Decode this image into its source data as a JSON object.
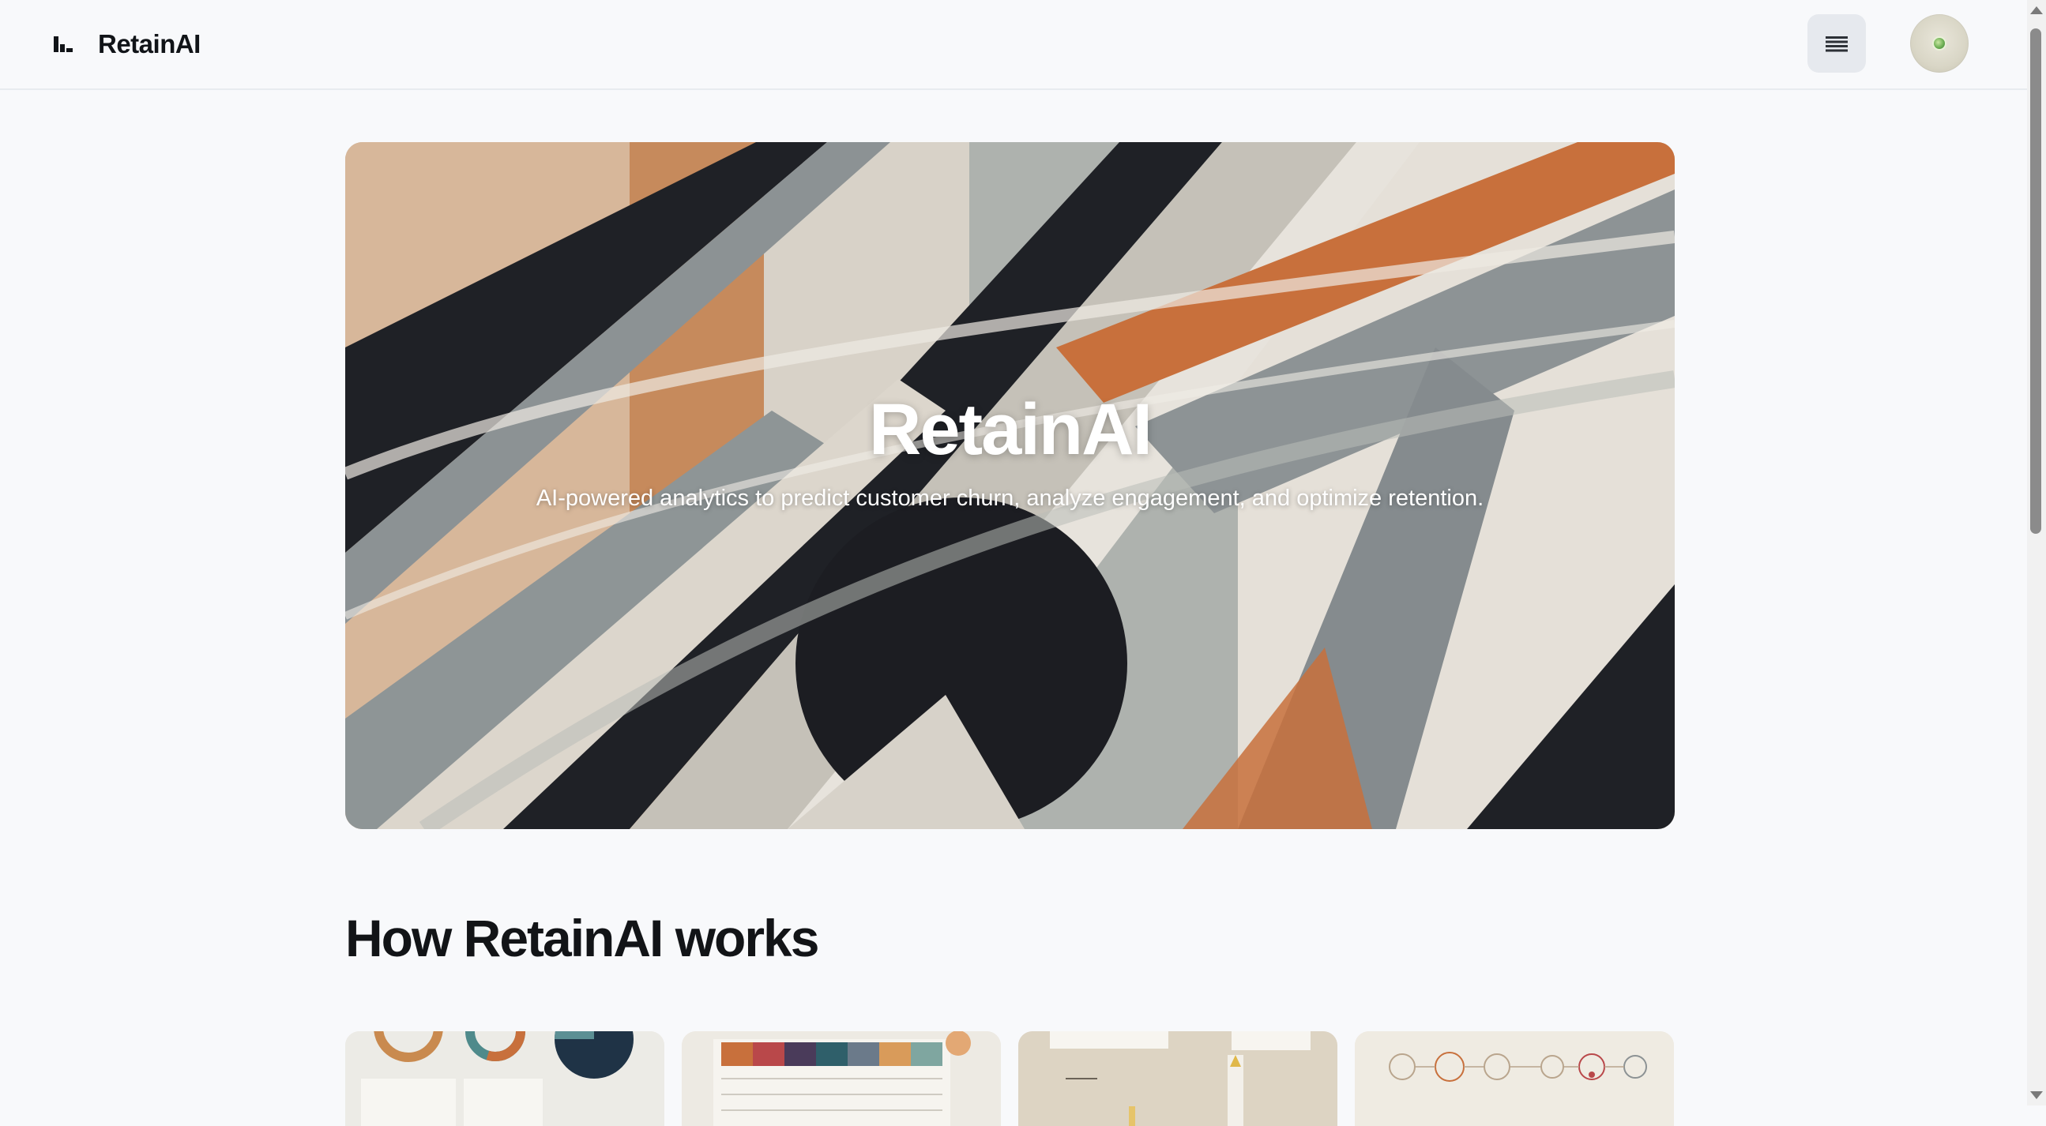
{
  "header": {
    "brand_name": "RetainAI",
    "logo_icon": "bar-chart-logo-icon",
    "menu_icon": "hamburger-menu-icon",
    "avatar_icon": "user-avatar-icon"
  },
  "hero": {
    "title": "RetainAI",
    "subtitle": "AI-powered analytics to predict customer churn, analyze engagement, and optimize retention."
  },
  "section": {
    "title": "How RetainAI works"
  },
  "cards": [
    {
      "image": "donut-charts-illustration"
    },
    {
      "image": "color-grid-table-illustration"
    },
    {
      "image": "documents-illustration"
    },
    {
      "image": "network-diagram-illustration"
    }
  ],
  "colors": {
    "background": "#f8f9fb",
    "text": "#111418",
    "accent_orange": "#c8703c",
    "accent_dark": "#1f2126",
    "accent_gray": "#8c9294"
  }
}
